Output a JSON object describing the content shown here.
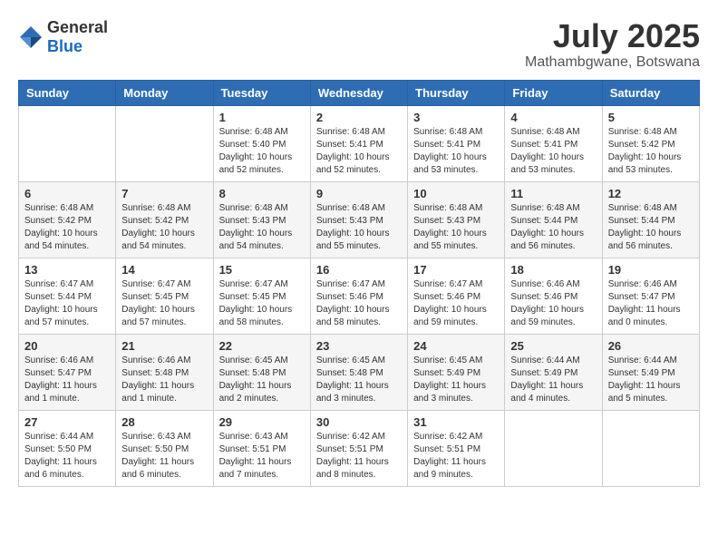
{
  "logo": {
    "general": "General",
    "blue": "Blue"
  },
  "title": "July 2025",
  "location": "Mathambgwane, Botswana",
  "days_of_week": [
    "Sunday",
    "Monday",
    "Tuesday",
    "Wednesday",
    "Thursday",
    "Friday",
    "Saturday"
  ],
  "weeks": [
    [
      {
        "day": "",
        "info": ""
      },
      {
        "day": "",
        "info": ""
      },
      {
        "day": "1",
        "info": "Sunrise: 6:48 AM\nSunset: 5:40 PM\nDaylight: 10 hours and 52 minutes."
      },
      {
        "day": "2",
        "info": "Sunrise: 6:48 AM\nSunset: 5:41 PM\nDaylight: 10 hours and 52 minutes."
      },
      {
        "day": "3",
        "info": "Sunrise: 6:48 AM\nSunset: 5:41 PM\nDaylight: 10 hours and 53 minutes."
      },
      {
        "day": "4",
        "info": "Sunrise: 6:48 AM\nSunset: 5:41 PM\nDaylight: 10 hours and 53 minutes."
      },
      {
        "day": "5",
        "info": "Sunrise: 6:48 AM\nSunset: 5:42 PM\nDaylight: 10 hours and 53 minutes."
      }
    ],
    [
      {
        "day": "6",
        "info": "Sunrise: 6:48 AM\nSunset: 5:42 PM\nDaylight: 10 hours and 54 minutes."
      },
      {
        "day": "7",
        "info": "Sunrise: 6:48 AM\nSunset: 5:42 PM\nDaylight: 10 hours and 54 minutes."
      },
      {
        "day": "8",
        "info": "Sunrise: 6:48 AM\nSunset: 5:43 PM\nDaylight: 10 hours and 54 minutes."
      },
      {
        "day": "9",
        "info": "Sunrise: 6:48 AM\nSunset: 5:43 PM\nDaylight: 10 hours and 55 minutes."
      },
      {
        "day": "10",
        "info": "Sunrise: 6:48 AM\nSunset: 5:43 PM\nDaylight: 10 hours and 55 minutes."
      },
      {
        "day": "11",
        "info": "Sunrise: 6:48 AM\nSunset: 5:44 PM\nDaylight: 10 hours and 56 minutes."
      },
      {
        "day": "12",
        "info": "Sunrise: 6:48 AM\nSunset: 5:44 PM\nDaylight: 10 hours and 56 minutes."
      }
    ],
    [
      {
        "day": "13",
        "info": "Sunrise: 6:47 AM\nSunset: 5:44 PM\nDaylight: 10 hours and 57 minutes."
      },
      {
        "day": "14",
        "info": "Sunrise: 6:47 AM\nSunset: 5:45 PM\nDaylight: 10 hours and 57 minutes."
      },
      {
        "day": "15",
        "info": "Sunrise: 6:47 AM\nSunset: 5:45 PM\nDaylight: 10 hours and 58 minutes."
      },
      {
        "day": "16",
        "info": "Sunrise: 6:47 AM\nSunset: 5:46 PM\nDaylight: 10 hours and 58 minutes."
      },
      {
        "day": "17",
        "info": "Sunrise: 6:47 AM\nSunset: 5:46 PM\nDaylight: 10 hours and 59 minutes."
      },
      {
        "day": "18",
        "info": "Sunrise: 6:46 AM\nSunset: 5:46 PM\nDaylight: 10 hours and 59 minutes."
      },
      {
        "day": "19",
        "info": "Sunrise: 6:46 AM\nSunset: 5:47 PM\nDaylight: 11 hours and 0 minutes."
      }
    ],
    [
      {
        "day": "20",
        "info": "Sunrise: 6:46 AM\nSunset: 5:47 PM\nDaylight: 11 hours and 1 minute."
      },
      {
        "day": "21",
        "info": "Sunrise: 6:46 AM\nSunset: 5:48 PM\nDaylight: 11 hours and 1 minute."
      },
      {
        "day": "22",
        "info": "Sunrise: 6:45 AM\nSunset: 5:48 PM\nDaylight: 11 hours and 2 minutes."
      },
      {
        "day": "23",
        "info": "Sunrise: 6:45 AM\nSunset: 5:48 PM\nDaylight: 11 hours and 3 minutes."
      },
      {
        "day": "24",
        "info": "Sunrise: 6:45 AM\nSunset: 5:49 PM\nDaylight: 11 hours and 3 minutes."
      },
      {
        "day": "25",
        "info": "Sunrise: 6:44 AM\nSunset: 5:49 PM\nDaylight: 11 hours and 4 minutes."
      },
      {
        "day": "26",
        "info": "Sunrise: 6:44 AM\nSunset: 5:49 PM\nDaylight: 11 hours and 5 minutes."
      }
    ],
    [
      {
        "day": "27",
        "info": "Sunrise: 6:44 AM\nSunset: 5:50 PM\nDaylight: 11 hours and 6 minutes."
      },
      {
        "day": "28",
        "info": "Sunrise: 6:43 AM\nSunset: 5:50 PM\nDaylight: 11 hours and 6 minutes."
      },
      {
        "day": "29",
        "info": "Sunrise: 6:43 AM\nSunset: 5:51 PM\nDaylight: 11 hours and 7 minutes."
      },
      {
        "day": "30",
        "info": "Sunrise: 6:42 AM\nSunset: 5:51 PM\nDaylight: 11 hours and 8 minutes."
      },
      {
        "day": "31",
        "info": "Sunrise: 6:42 AM\nSunset: 5:51 PM\nDaylight: 11 hours and 9 minutes."
      },
      {
        "day": "",
        "info": ""
      },
      {
        "day": "",
        "info": ""
      }
    ]
  ]
}
